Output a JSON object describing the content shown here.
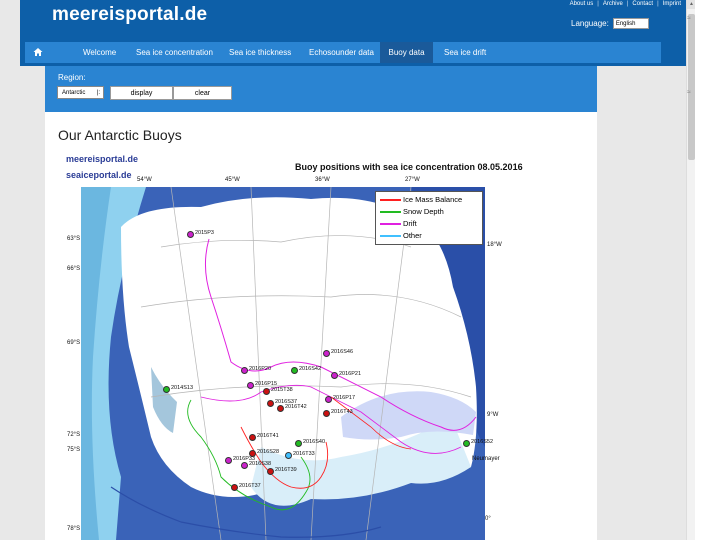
{
  "header": {
    "logo": "meereisportal.de",
    "top_links": [
      "About us",
      "Archive",
      "Contact",
      "Imprint"
    ],
    "language_label": "Language:",
    "language_value": "English"
  },
  "nav": {
    "items": [
      {
        "label": "Welcome",
        "active": false
      },
      {
        "label": "Sea ice concentration",
        "active": false
      },
      {
        "label": "Sea ice thickness",
        "active": false
      },
      {
        "label": "Echosounder data",
        "active": false
      },
      {
        "label": "Buoy data",
        "active": true
      },
      {
        "label": "Sea ice drift",
        "active": false
      }
    ]
  },
  "panel": {
    "region_label": "Region:",
    "region_value": "Antarctic",
    "display_label": "display",
    "clear_label": "clear"
  },
  "content": {
    "page_title": "Our Antarctic Buoys"
  },
  "figure": {
    "brand_1": "meereisportal.de",
    "brand_2": "seaiceportal.de",
    "title": "Buoy positions with sea ice concentration 08.05.2016",
    "legend": [
      {
        "label": "Ice Mass Balance",
        "color": "#ff2020"
      },
      {
        "label": "Snow Depth",
        "color": "#22bb22"
      },
      {
        "label": "Drift",
        "color": "#e020e0"
      },
      {
        "label": "Other",
        "color": "#40c0ff"
      }
    ],
    "coords": {
      "lon_1": "54°W",
      "lon_2": "45°W",
      "lon_3": "36°W",
      "lon_4": "27°W",
      "lon_5": "18°W",
      "lon_6": "9°W",
      "lat_1": "63°S",
      "lat_2": "66°S",
      "lat_3": "69°S",
      "lat_4": "72°S",
      "lat_5": "75°S",
      "lat_6": "78°S",
      "bottom_0": "0°"
    },
    "buoy_labels": [
      {
        "label": "2015P3",
        "color": "#cc22cc"
      },
      {
        "label": "2016S46",
        "color": "#cc22cc"
      },
      {
        "label": "2016P20",
        "color": "#cc22cc"
      },
      {
        "label": "2016S42",
        "color": "#22bb22"
      },
      {
        "label": "2016P21",
        "color": "#cc22cc"
      },
      {
        "label": "2014S13",
        "color": "#22bb22"
      },
      {
        "label": "2016P15",
        "color": "#cc22cc"
      },
      {
        "label": "2015T38",
        "color": "#cc1111"
      },
      {
        "label": "2016S37",
        "color": "#cc1111"
      },
      {
        "label": "2016T42",
        "color": "#cc1111"
      },
      {
        "label": "2016P17",
        "color": "#cc22cc"
      },
      {
        "label": "2016T43",
        "color": "#cc1111"
      },
      {
        "label": "2016T41",
        "color": "#cc1111"
      },
      {
        "label": "2016S40",
        "color": "#22bb22"
      },
      {
        "label": "2016S28",
        "color": "#cc1111"
      },
      {
        "label": "2016T33",
        "color": "#40c0ff"
      },
      {
        "label": "2016P33",
        "color": "#cc22cc"
      },
      {
        "label": "2016S38",
        "color": "#cc22cc"
      },
      {
        "label": "2016T39",
        "color": "#cc1111"
      },
      {
        "label": "2016T37",
        "color": "#cc1111"
      },
      {
        "label": "2016S52",
        "color": "#22bb22"
      }
    ],
    "place_label": "Neumayer"
  }
}
